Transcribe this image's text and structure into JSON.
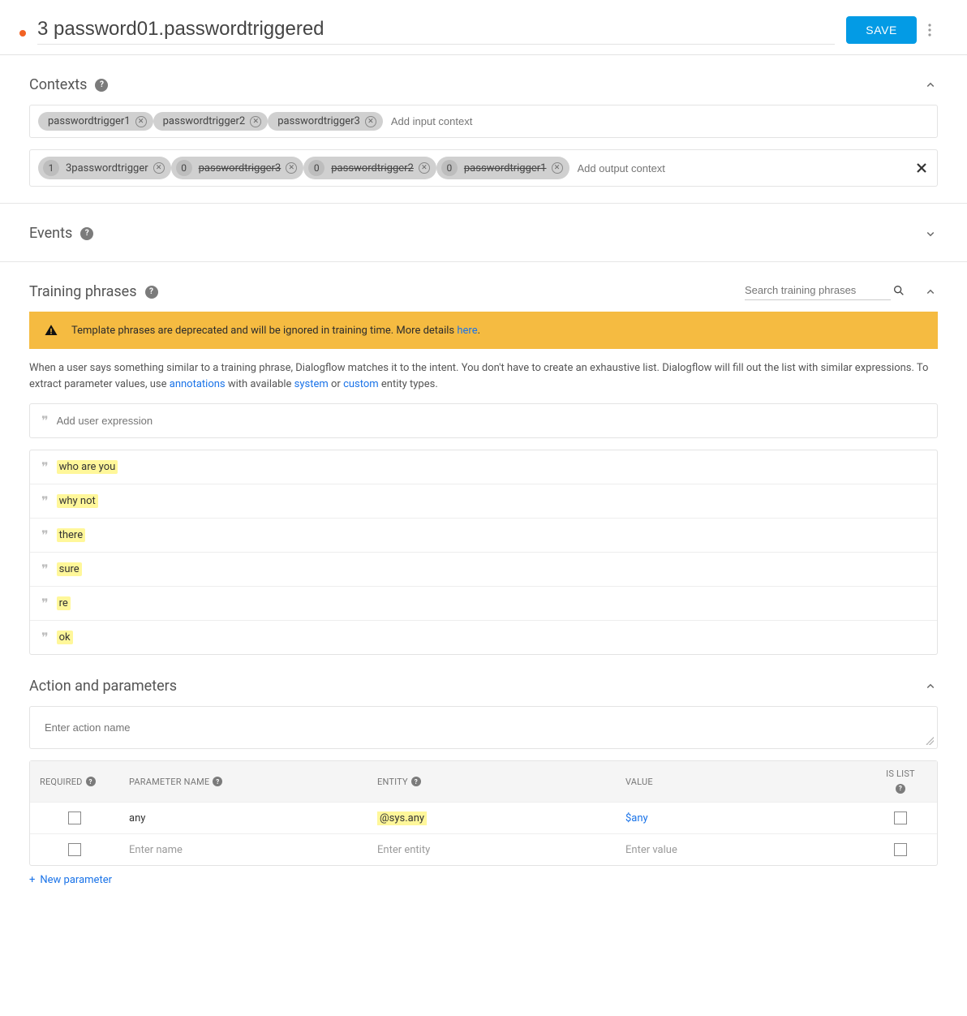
{
  "header": {
    "intent_name": "3 password01.passwordtriggered",
    "save_label": "SAVE"
  },
  "contexts": {
    "title": "Contexts",
    "input_placeholder": "Add input context",
    "output_placeholder": "Add output context",
    "input": [
      {
        "label": "passwordtrigger1"
      },
      {
        "label": "passwordtrigger2"
      },
      {
        "label": "passwordtrigger3"
      }
    ],
    "output": [
      {
        "count": "1",
        "label": "3passwordtrigger",
        "strike": false
      },
      {
        "count": "0",
        "label": "passwordtrigger3",
        "strike": true
      },
      {
        "count": "0",
        "label": "passwordtrigger2",
        "strike": true
      },
      {
        "count": "0",
        "label": "passwordtrigger1",
        "strike": true
      }
    ]
  },
  "events": {
    "title": "Events"
  },
  "training": {
    "title": "Training phrases",
    "search_placeholder": "Search training phrases",
    "warning_text": "Template phrases are deprecated and will be ignored in training time. More details ",
    "warning_link": "here",
    "desc_pre": "When a user says something similar to a training phrase, Dialogflow matches it to the intent. You don't have to create an exhaustive list. Dialogflow will fill out the list with similar expressions. To extract parameter values, use ",
    "desc_annotations": "annotations",
    "desc_mid": " with available ",
    "desc_system": "system",
    "desc_or": " or ",
    "desc_custom": "custom",
    "desc_end": " entity types.",
    "add_placeholder": "Add user expression",
    "phrases": [
      "who are you",
      "why not",
      "there",
      "sure",
      "re",
      "ok"
    ]
  },
  "action": {
    "title": "Action and parameters",
    "action_placeholder": "Enter action name",
    "headers": {
      "required": "REQUIRED",
      "param_name": "PARAMETER NAME",
      "entity": "ENTITY",
      "value": "VALUE",
      "is_list": "IS LIST"
    },
    "rows": [
      {
        "name": "any",
        "entity": "@sys.any",
        "value": "$any",
        "placeholder": false
      },
      {
        "name": "Enter name",
        "entity": "Enter entity",
        "value": "Enter value",
        "placeholder": true
      }
    ],
    "new_param_label": "New parameter"
  }
}
